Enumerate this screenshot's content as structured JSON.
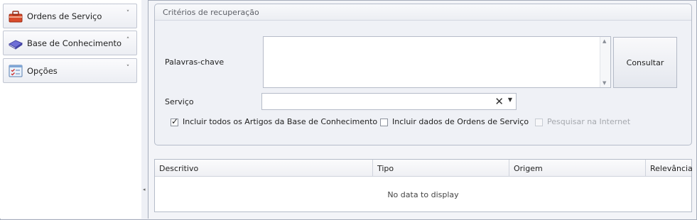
{
  "sidebar": {
    "items": [
      {
        "label": "Ordens de Serviço",
        "icon": "toolbox-icon",
        "chevron": "˅"
      },
      {
        "label": "Base de Conhecimento",
        "icon": "book-icon",
        "chevron": "˄"
      },
      {
        "label": "Opções",
        "icon": "options-checklist-icon",
        "chevron": "˅"
      }
    ]
  },
  "criteria": {
    "title": "Critérios de recuperação",
    "keywords_label": "Palavras-chave",
    "keywords_value": "",
    "search_button": "Consultar",
    "service_label": "Serviço",
    "service_value": "",
    "checkboxes": [
      {
        "label": "Incluir todos os Artigos da Base de Conhecimento",
        "checked": true,
        "enabled": true
      },
      {
        "label": "Incluir dados de Ordens de Serviço",
        "checked": false,
        "enabled": true
      },
      {
        "label": "Pesquisar na Internet",
        "checked": false,
        "enabled": false
      }
    ]
  },
  "grid": {
    "columns": [
      "Descritivo",
      "Tipo",
      "Origem",
      "Relevância"
    ],
    "empty_text": "No data to display"
  }
}
